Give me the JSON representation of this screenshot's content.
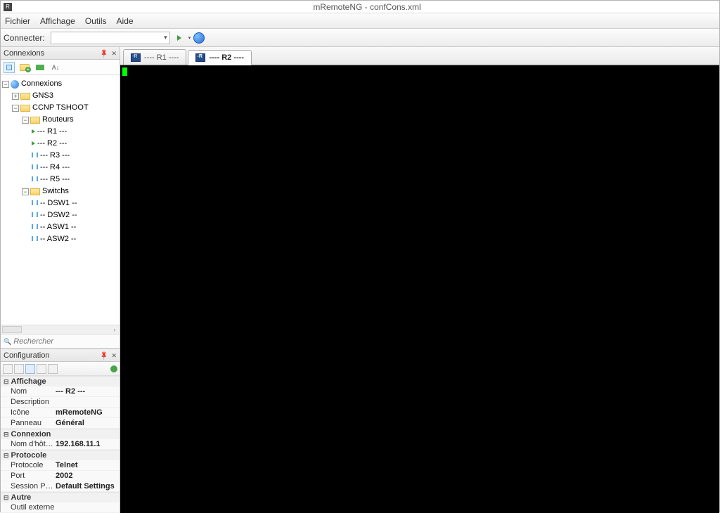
{
  "window": {
    "title": "mRemoteNG - confCons.xml"
  },
  "menu": {
    "items": [
      "Fichier",
      "Affichage",
      "Outils",
      "Aide"
    ]
  },
  "connectBar": {
    "label": "Connecter:"
  },
  "connectionsPanel": {
    "title": "Connexions",
    "root": "Connexions",
    "folders": {
      "gns3": "GNS3",
      "ccnp": "CCNP TSHOOT",
      "routeurs": "Routeurs",
      "switchs": "Switchs"
    },
    "routers": [
      "---  R1  ---",
      "---  R2  ---",
      "---  R3  ---",
      "---  R4  ---",
      "---  R5  ---"
    ],
    "switches": [
      "-- DSW1 --",
      "-- DSW2 --",
      "-- ASW1 --",
      "-- ASW2 --"
    ],
    "searchPlaceholder": "Rechercher"
  },
  "configPanel": {
    "title": "Configuration",
    "categories": {
      "affichage": "Affichage",
      "connexion": "Connexion",
      "protocole": "Protocole",
      "autre": "Autre"
    },
    "props": {
      "nom_label": "Nom",
      "nom_value": "---  R2  ---",
      "desc_label": "Description",
      "desc_value": "",
      "icone_label": "Icône",
      "icone_value": "mRemoteNG",
      "panneau_label": "Panneau",
      "panneau_value": "Général",
      "host_label": "Nom d'hôte / I",
      "host_value": "192.168.11.1",
      "proto_label": "Protocole",
      "proto_value": "Telnet",
      "port_label": "Port",
      "port_value": "2002",
      "putty_label": "Session PuTT",
      "putty_value": "Default Settings",
      "outil_label": "Outil externe",
      "outil_value": ""
    }
  },
  "tabs": [
    {
      "label": "----  R1  ----",
      "active": false
    },
    {
      "label": "----  R2  ----",
      "active": true
    }
  ]
}
